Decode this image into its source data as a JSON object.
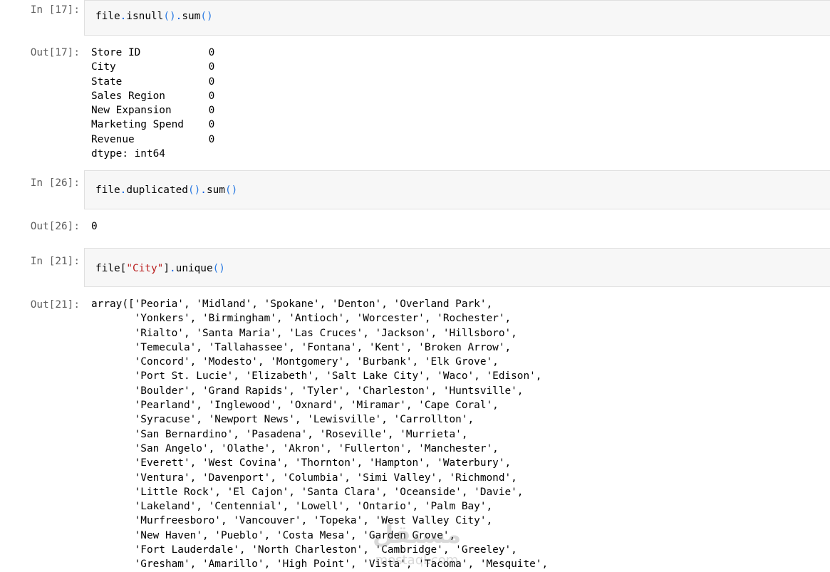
{
  "cells": [
    {
      "in_prompt": "In [17]:",
      "code": {
        "obj": "file",
        "dot1": ".",
        "m1": "isnull",
        "p1": "()",
        "dot2": ".",
        "m2": "sum",
        "p2": "()"
      },
      "out_prompt": "Out[17]:",
      "output": "Store ID           0\nCity               0\nState              0\nSales Region       0\nNew Expansion      0\nMarketing Spend    0\nRevenue            0\ndtype: int64"
    },
    {
      "in_prompt": "In [26]:",
      "code": {
        "obj": "file",
        "dot1": ".",
        "m1": "duplicated",
        "p1": "()",
        "dot2": ".",
        "m2": "sum",
        "p2": "()"
      },
      "out_prompt": "Out[26]:",
      "output": "0"
    },
    {
      "in_prompt": "In [21]:",
      "code": {
        "obj": "file",
        "br_open": "[",
        "str": "\"City\"",
        "br_close": "]",
        "dot": ".",
        "m": "unique",
        "p": "()"
      },
      "out_prompt": "Out[21]:",
      "output": "array(['Peoria', 'Midland', 'Spokane', 'Denton', 'Overland Park',\n       'Yonkers', 'Birmingham', 'Antioch', 'Worcester', 'Rochester',\n       'Rialto', 'Santa Maria', 'Las Cruces', 'Jackson', 'Hillsboro',\n       'Temecula', 'Tallahassee', 'Fontana', 'Kent', 'Broken Arrow',\n       'Concord', 'Modesto', 'Montgomery', 'Burbank', 'Elk Grove',\n       'Port St. Lucie', 'Elizabeth', 'Salt Lake City', 'Waco', 'Edison',\n       'Boulder', 'Grand Rapids', 'Tyler', 'Charleston', 'Huntsville',\n       'Pearland', 'Inglewood', 'Oxnard', 'Miramar', 'Cape Coral',\n       'Syracuse', 'Newport News', 'Lewisville', 'Carrollton',\n       'San Bernardino', 'Pasadena', 'Roseville', 'Murrieta',\n       'San Angelo', 'Olathe', 'Akron', 'Fullerton', 'Manchester',\n       'Everett', 'West Covina', 'Thornton', 'Hampton', 'Waterbury',\n       'Ventura', 'Davenport', 'Columbia', 'Simi Valley', 'Richmond',\n       'Little Rock', 'El Cajon', 'Santa Clara', 'Oceanside', 'Davie',\n       'Lakeland', 'Centennial', 'Lowell', 'Ontario', 'Palm Bay',\n       'Murfreesboro', 'Vancouver', 'Topeka', 'West Valley City',\n       'New Haven', 'Pueblo', 'Costa Mesa', 'Garden Grove',\n       'Fort Lauderdale', 'North Charleston', 'Cambridge', 'Greeley',\n       'Gresham', 'Amarillo', 'High Point', 'Vista', 'Tacoma', 'Mesquite',"
    }
  ],
  "watermark": {
    "text": "مستقل",
    "sub": "mostaql.com"
  }
}
